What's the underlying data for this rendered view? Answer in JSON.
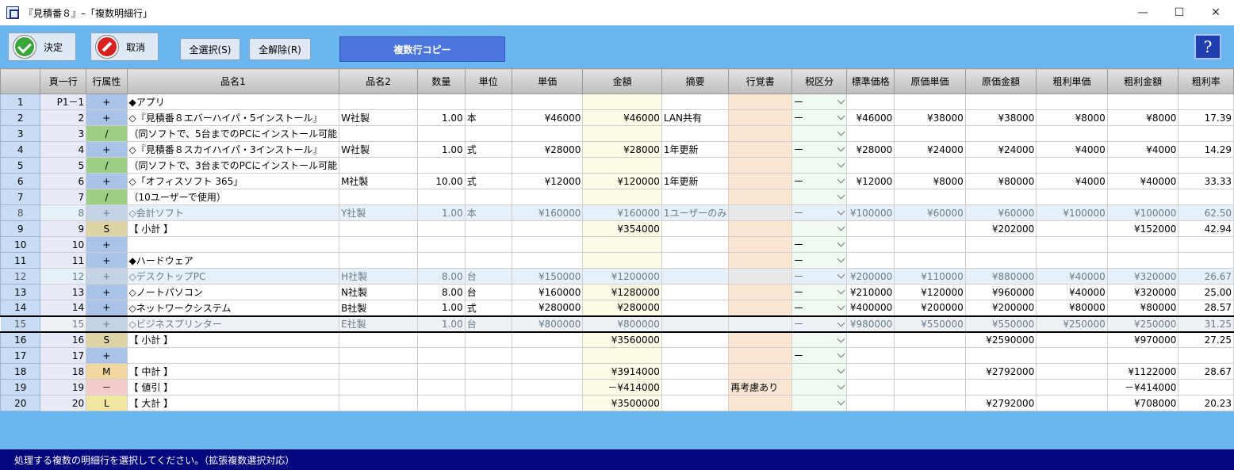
{
  "window": {
    "title": "『見積番８』–「複数明細行」",
    "minimize": "—",
    "maximize": "☐",
    "close": "✕"
  },
  "toolbar": {
    "ok_label": "決定",
    "cancel_label": "取消",
    "select_all_label": "全選択(S)",
    "deselect_all_label": "全解除(R)",
    "copy_rows_label": "複数行コピー",
    "help_label": "?"
  },
  "grid": {
    "columns": [
      "",
      "頁一行",
      "行属性",
      "品名1",
      "品名2",
      "数量",
      "単位",
      "単価",
      "金額",
      "摘要",
      "行覚書",
      "税区分",
      "標準価格",
      "原価単価",
      "原価金額",
      "粗利単価",
      "粗利金額",
      "粗利率"
    ],
    "rows": [
      {
        "no": "1",
        "pg": "P1－1",
        "attr": "+",
        "name1": "◆アプリ",
        "name2": "",
        "qty": "",
        "unit": "",
        "price": "",
        "amount": "",
        "summary": "",
        "memo": "",
        "tax": "ー",
        "std": "",
        "cost_u": "",
        "cost_amt": "",
        "gp_u": "",
        "gp_amt": "",
        "gp_rate": ""
      },
      {
        "no": "2",
        "pg": "2",
        "attr": "+",
        "name1": "◇『見積番８エバーハイパ・5インストール』",
        "name2": "W社製",
        "qty": "1.00",
        "unit": "本",
        "price": "¥46000",
        "amount": "¥46000",
        "summary": "LAN共有",
        "memo": "",
        "tax": "ー",
        "std": "¥46000",
        "cost_u": "¥38000",
        "cost_amt": "¥38000",
        "gp_u": "¥8000",
        "gp_amt": "¥8000",
        "gp_rate": "17.39"
      },
      {
        "no": "3",
        "pg": "3",
        "attr": "/",
        "name1": "（同ソフトで、5台までのPCにインストール可能",
        "name2": "",
        "qty": "",
        "unit": "",
        "price": "",
        "amount": "",
        "summary": "",
        "memo": "",
        "tax": "",
        "std": "",
        "cost_u": "",
        "cost_amt": "",
        "gp_u": "",
        "gp_amt": "",
        "gp_rate": ""
      },
      {
        "no": "4",
        "pg": "4",
        "attr": "+",
        "name1": "◇『見積番８スカイハイパ・3インストール』",
        "name2": "W社製",
        "qty": "1.00",
        "unit": "式",
        "price": "¥28000",
        "amount": "¥28000",
        "summary": "1年更新",
        "memo": "",
        "tax": "ー",
        "std": "¥28000",
        "cost_u": "¥24000",
        "cost_amt": "¥24000",
        "gp_u": "¥4000",
        "gp_amt": "¥4000",
        "gp_rate": "14.29"
      },
      {
        "no": "5",
        "pg": "5",
        "attr": "/",
        "name1": "（同ソフトで、3台までのPCにインストール可能",
        "name2": "",
        "qty": "",
        "unit": "",
        "price": "",
        "amount": "",
        "summary": "",
        "memo": "",
        "tax": "",
        "std": "",
        "cost_u": "",
        "cost_amt": "",
        "gp_u": "",
        "gp_amt": "",
        "gp_rate": ""
      },
      {
        "no": "6",
        "pg": "6",
        "attr": "+",
        "name1": "◇「オフィスソフト 365」",
        "name2": "M社製",
        "qty": "10.00",
        "unit": "式",
        "price": "¥12000",
        "amount": "¥120000",
        "summary": "1年更新",
        "memo": "",
        "tax": "ー",
        "std": "¥12000",
        "cost_u": "¥8000",
        "cost_amt": "¥80000",
        "gp_u": "¥4000",
        "gp_amt": "¥40000",
        "gp_rate": "33.33"
      },
      {
        "no": "7",
        "pg": "7",
        "attr": "/",
        "name1": "（10ユーザーで使用）",
        "name2": "",
        "qty": "",
        "unit": "",
        "price": "",
        "amount": "",
        "summary": "",
        "memo": "",
        "tax": "",
        "std": "",
        "cost_u": "",
        "cost_amt": "",
        "gp_u": "",
        "gp_amt": "",
        "gp_rate": ""
      },
      {
        "no": "8",
        "pg": "8",
        "attr": "+",
        "name1": "◇会計ソフト",
        "name2": "Y社製",
        "qty": "1.00",
        "unit": "本",
        "price": "¥160000",
        "amount": "¥160000",
        "summary": "1ユーザーのみ",
        "memo": "",
        "tax": "ー",
        "std": "¥100000",
        "cost_u": "¥60000",
        "cost_amt": "¥60000",
        "gp_u": "¥100000",
        "gp_amt": "¥100000",
        "gp_rate": "62.50"
      },
      {
        "no": "9",
        "pg": "9",
        "attr": "S",
        "name1": "【 小計 】",
        "name2": "",
        "qty": "",
        "unit": "",
        "price": "",
        "amount": "¥354000",
        "summary": "",
        "memo": "",
        "tax": "",
        "std": "",
        "cost_u": "",
        "cost_amt": "¥202000",
        "gp_u": "",
        "gp_amt": "¥152000",
        "gp_rate": "42.94"
      },
      {
        "no": "10",
        "pg": "10",
        "attr": "+",
        "name1": "",
        "name2": "",
        "qty": "",
        "unit": "",
        "price": "",
        "amount": "",
        "summary": "",
        "memo": "",
        "tax": "ー",
        "std": "",
        "cost_u": "",
        "cost_amt": "",
        "gp_u": "",
        "gp_amt": "",
        "gp_rate": ""
      },
      {
        "no": "11",
        "pg": "11",
        "attr": "+",
        "name1": "◆ハードウェア",
        "name2": "",
        "qty": "",
        "unit": "",
        "price": "",
        "amount": "",
        "summary": "",
        "memo": "",
        "tax": "ー",
        "std": "",
        "cost_u": "",
        "cost_amt": "",
        "gp_u": "",
        "gp_amt": "",
        "gp_rate": ""
      },
      {
        "no": "12",
        "pg": "12",
        "attr": "+",
        "name1": "◇デスクトップPC",
        "name2": "H社製",
        "qty": "8.00",
        "unit": "台",
        "price": "¥150000",
        "amount": "¥1200000",
        "summary": "",
        "memo": "",
        "tax": "ー",
        "std": "¥200000",
        "cost_u": "¥110000",
        "cost_amt": "¥880000",
        "gp_u": "¥40000",
        "gp_amt": "¥320000",
        "gp_rate": "26.67"
      },
      {
        "no": "13",
        "pg": "13",
        "attr": "+",
        "name1": "◇ノートパソコン",
        "name2": "N社製",
        "qty": "8.00",
        "unit": "台",
        "price": "¥160000",
        "amount": "¥1280000",
        "summary": "",
        "memo": "",
        "tax": "ー",
        "std": "¥210000",
        "cost_u": "¥120000",
        "cost_amt": "¥960000",
        "gp_u": "¥40000",
        "gp_amt": "¥320000",
        "gp_rate": "25.00"
      },
      {
        "no": "14",
        "pg": "14",
        "attr": "+",
        "name1": "◇ネットワークシステム",
        "name2": "B社製",
        "qty": "1.00",
        "unit": "式",
        "price": "¥280000",
        "amount": "¥280000",
        "summary": "",
        "memo": "",
        "tax": "ー",
        "std": "¥400000",
        "cost_u": "¥200000",
        "cost_amt": "¥200000",
        "gp_u": "¥80000",
        "gp_amt": "¥80000",
        "gp_rate": "28.57"
      },
      {
        "no": "15",
        "pg": "15",
        "attr": "+",
        "name1": "◇ビジネスプリンター",
        "name2": "E社製",
        "qty": "1.00",
        "unit": "台",
        "price": "¥800000",
        "amount": "¥800000",
        "summary": "",
        "memo": "",
        "tax": "ー",
        "std": "¥980000",
        "cost_u": "¥550000",
        "cost_amt": "¥550000",
        "gp_u": "¥250000",
        "gp_amt": "¥250000",
        "gp_rate": "31.25"
      },
      {
        "no": "16",
        "pg": "16",
        "attr": "S",
        "name1": "【 小計 】",
        "name2": "",
        "qty": "",
        "unit": "",
        "price": "",
        "amount": "¥3560000",
        "summary": "",
        "memo": "",
        "tax": "",
        "std": "",
        "cost_u": "",
        "cost_amt": "¥2590000",
        "gp_u": "",
        "gp_amt": "¥970000",
        "gp_rate": "27.25"
      },
      {
        "no": "17",
        "pg": "17",
        "attr": "+",
        "name1": "",
        "name2": "",
        "qty": "",
        "unit": "",
        "price": "",
        "amount": "",
        "summary": "",
        "memo": "",
        "tax": "ー",
        "std": "",
        "cost_u": "",
        "cost_amt": "",
        "gp_u": "",
        "gp_amt": "",
        "gp_rate": ""
      },
      {
        "no": "18",
        "pg": "18",
        "attr": "M",
        "name1": "【 中計 】",
        "name2": "",
        "qty": "",
        "unit": "",
        "price": "",
        "amount": "¥3914000",
        "summary": "",
        "memo": "",
        "tax": "",
        "std": "",
        "cost_u": "",
        "cost_amt": "¥2792000",
        "gp_u": "",
        "gp_amt": "¥1122000",
        "gp_rate": "28.67"
      },
      {
        "no": "19",
        "pg": "19",
        "attr": "－",
        "name1": "【 値引 】",
        "name2": "",
        "qty": "",
        "unit": "",
        "price": "",
        "amount": "－¥414000",
        "summary": "",
        "memo": "再考慮あり",
        "tax": "",
        "std": "",
        "cost_u": "",
        "cost_amt": "",
        "gp_u": "",
        "gp_amt": "－¥414000",
        "gp_rate": ""
      },
      {
        "no": "20",
        "pg": "20",
        "attr": "L",
        "name1": "【 大計 】",
        "name2": "",
        "qty": "",
        "unit": "",
        "price": "",
        "amount": "¥3500000",
        "summary": "",
        "memo": "",
        "tax": "",
        "std": "",
        "cost_u": "",
        "cost_amt": "¥2792000",
        "gp_u": "",
        "gp_amt": "¥708000",
        "gp_rate": "20.23"
      }
    ]
  },
  "status": {
    "message": "処理する複数の明細行を選択してください。（拡張複数選択対応）"
  }
}
